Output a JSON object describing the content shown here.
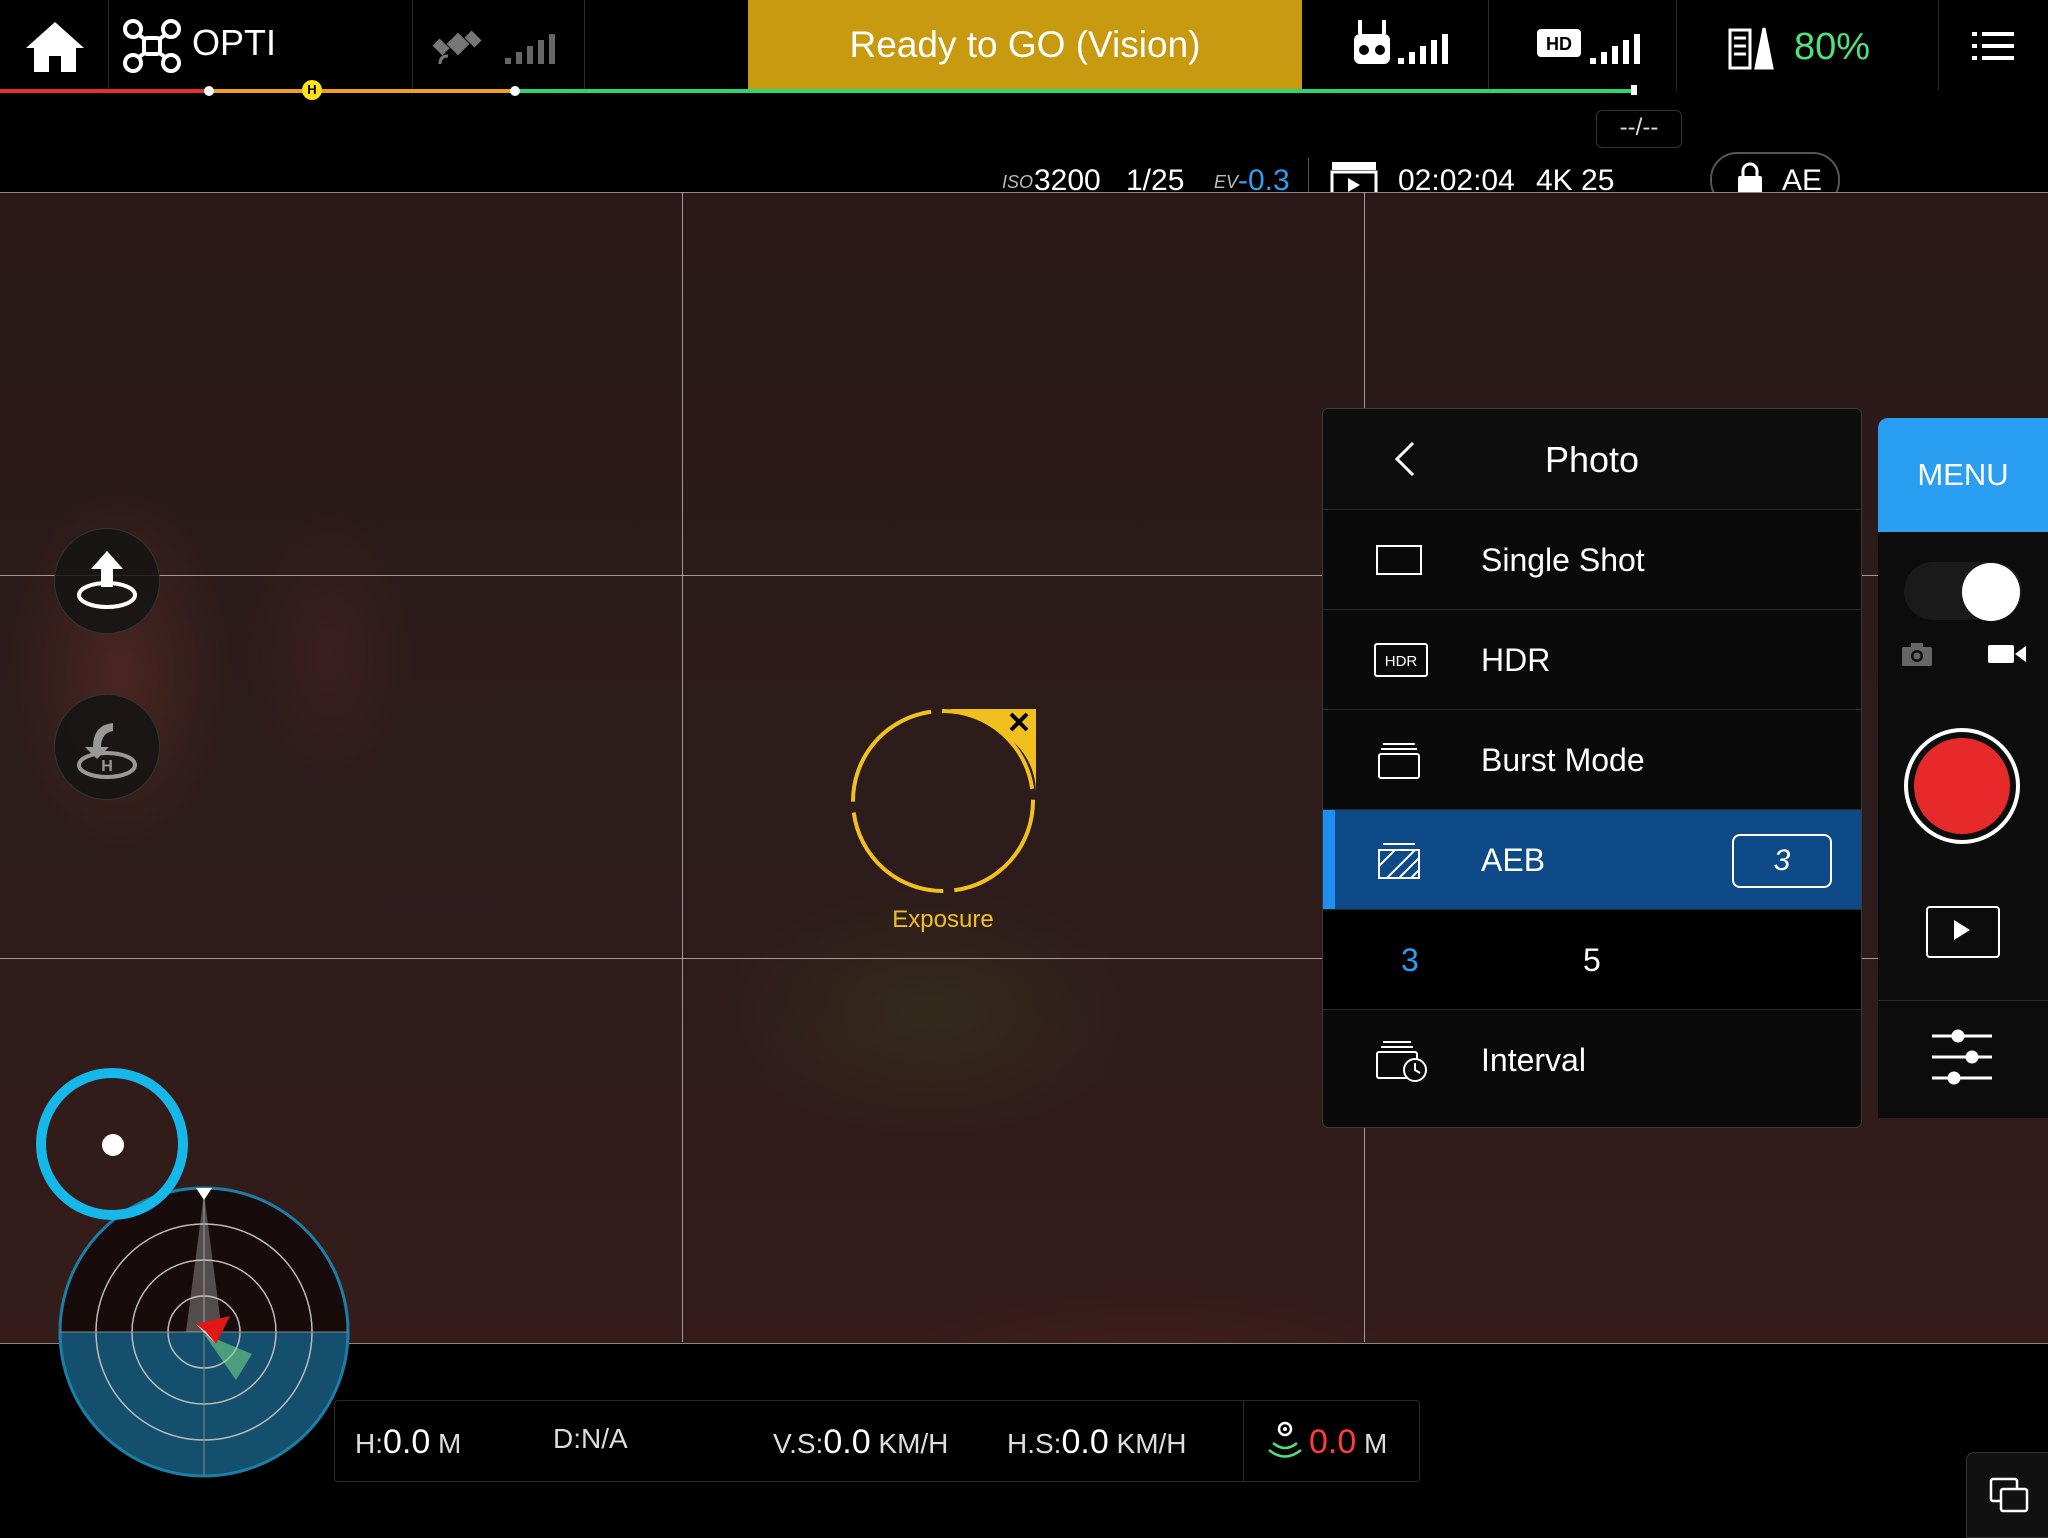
{
  "top_bar": {
    "aircraft_name": "OPTI",
    "status": "Ready to GO (Vision)",
    "battery_percent": "80%",
    "time_remaining": "--/--",
    "hd_label": "HD",
    "gps_signal_bars": 0,
    "rc_signal_bars": 5,
    "hd_signal_bars": 5,
    "colors": {
      "status_bg": "#c89a10",
      "battery_text": "#4ee07a"
    }
  },
  "camera_params": {
    "iso_label": "ISO",
    "iso": "3200",
    "shutter": "1/25",
    "ev_label": "EV",
    "ev": "-0.3",
    "record_time": "02:02:04",
    "video_format": "4K 25",
    "ae_lock": "AE"
  },
  "viewfinder": {
    "exposure_label": "Exposure"
  },
  "photo_menu": {
    "title": "Photo",
    "options": [
      {
        "label": "Single Shot",
        "icon": "single-shot-icon"
      },
      {
        "label": "HDR",
        "icon": "hdr-icon",
        "badge": "HDR"
      },
      {
        "label": "Burst Mode",
        "icon": "burst-icon"
      },
      {
        "label": "AEB",
        "icon": "aeb-icon",
        "value": "3",
        "selected": true
      },
      {
        "label": "Interval",
        "icon": "interval-icon"
      }
    ],
    "aeb_choices": [
      "3",
      "5"
    ],
    "aeb_selected": "3"
  },
  "right_controls": {
    "menu_label": "MENU"
  },
  "telemetry": {
    "height_label": "H:",
    "height_value": "0.0",
    "height_unit": "M",
    "distance": "D:N/A",
    "vs_label": "V.S:",
    "vs_value": "0.0",
    "vs_unit": "KM/H",
    "hs_label": "H.S:",
    "hs_value": "0.0",
    "hs_unit": "KM/H",
    "dist_value": "0.0",
    "dist_unit": "M"
  }
}
